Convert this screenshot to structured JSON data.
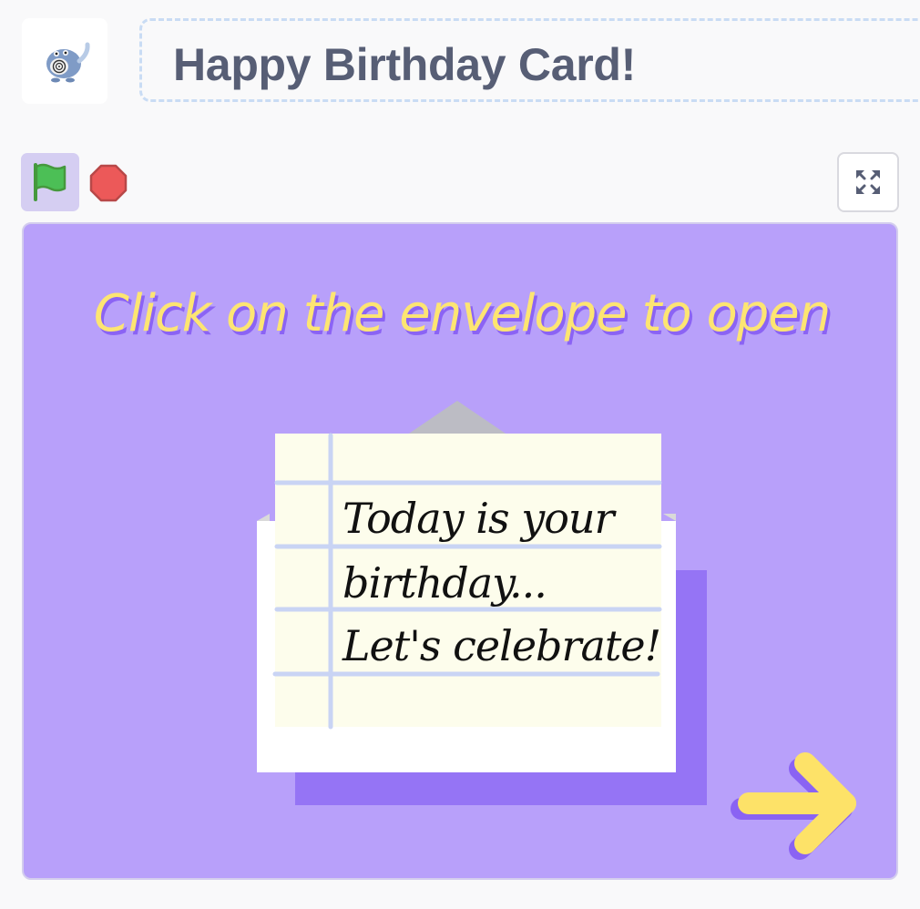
{
  "header": {
    "project_title": "Happy Birthday Card!",
    "avatar_icon": "poliwag-avatar-icon"
  },
  "controls": {
    "green_flag_icon": "green-flag-icon",
    "stop_icon": "stop-sign-icon",
    "fullscreen_icon": "fullscreen-icon"
  },
  "stage": {
    "instruction": "Click on the envelope to open",
    "letter_lines": [
      "Today is your",
      "birthday...",
      "Let's celebrate!"
    ],
    "arrow_icon": "next-arrow-icon",
    "colors": {
      "background": "#b8a0fa",
      "text_yellow": "#fde572",
      "envelope_purple": "#9574f5",
      "paper": "#fdfdec",
      "lines": "#c9d4f4"
    }
  }
}
